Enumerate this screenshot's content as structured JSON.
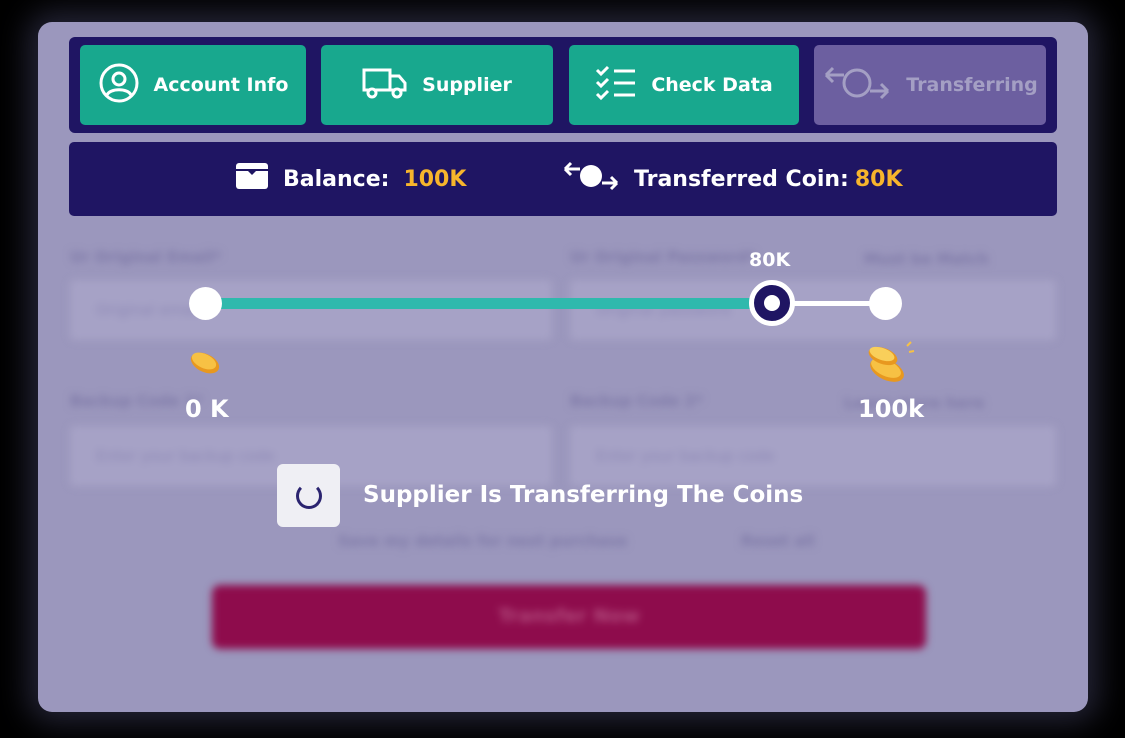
{
  "tabs": [
    {
      "label": "Account Info",
      "icon": "user-circle-icon"
    },
    {
      "label": "Supplier",
      "icon": "truck-icon"
    },
    {
      "label": "Check Data",
      "icon": "checklist-icon"
    },
    {
      "label": "Transferring",
      "icon": "transfer-arrows-icon",
      "disabled": true
    }
  ],
  "balance": {
    "label": "Balance:",
    "value": "100K",
    "icon": "wallet-icon"
  },
  "transferred": {
    "label": "Transferred Coin:",
    "value": "80K",
    "icon": "coin-transfer-icon"
  },
  "form": {
    "email_label": "Ur Original Email*",
    "email_placeholder": "Original email",
    "password_label": "Ur Original Password*",
    "password_link": "Must be Match",
    "password_placeholder": "Original password",
    "backup1_label": "Backup Code 1*",
    "backup1_placeholder": "Enter your backup code",
    "backup2_label": "Backup Code 2*",
    "backup2_link": "Learn more here",
    "backup2_placeholder": "Enter your backup code",
    "save_label": "Save my details for next purchase",
    "reset_label": "Reset all",
    "submit_label": "Transfer Now"
  },
  "slider": {
    "min_label": "0 K",
    "max_label": "100k",
    "current_label": "80K",
    "current_fraction": 0.8
  },
  "status": {
    "text": "Supplier Is Transferring The Coins"
  },
  "colors": {
    "tab_green": "#18a88e",
    "navy": "#1f1563",
    "accent_orange": "#f7b52c",
    "track_teal": "#2fb9ad",
    "submit_magenta": "#8e0c4c"
  }
}
